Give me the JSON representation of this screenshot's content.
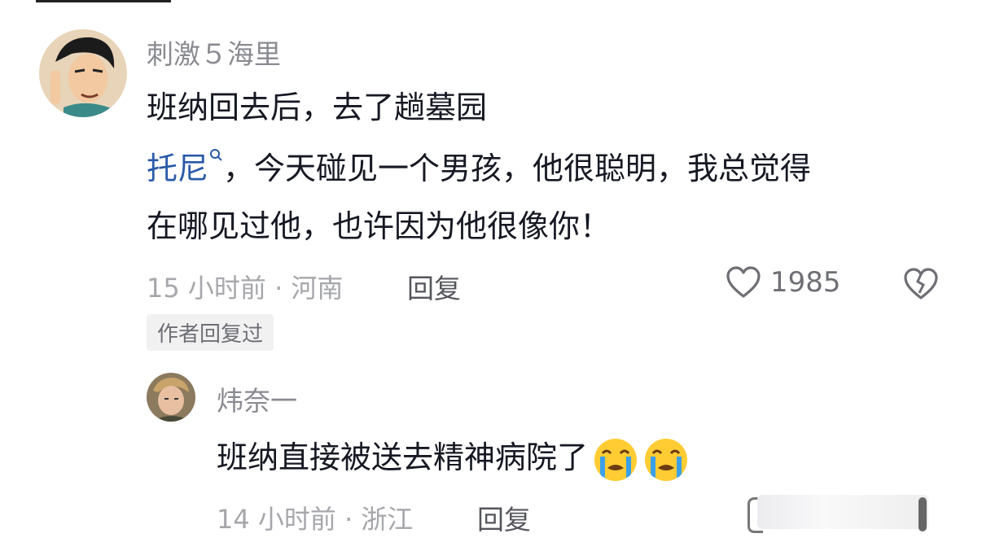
{
  "comment": {
    "username": "刺激５海里",
    "text_line1": "班纳回去后，去了趟墓园",
    "mention": "托尼",
    "text_line2_rest": "，今天碰见一个男孩，他很聪明，我总觉得",
    "text_line3": "在哪见过他，也许因为他很像你！",
    "meta": "15 小时前 · 河南",
    "reply_label": "回复",
    "like_count": "1985",
    "author_badge": "作者回复过"
  },
  "reply": {
    "username": "炜奈一",
    "text": "班纳直接被送去精神病院了",
    "emojis": [
      "crying-emoji",
      "crying-emoji"
    ],
    "meta": "14 小时前 · 浙江",
    "reply_label": "回复"
  },
  "colors": {
    "mention": "#2a5aa8",
    "meta": "#a6a7ab",
    "username": "#8a8b91"
  }
}
